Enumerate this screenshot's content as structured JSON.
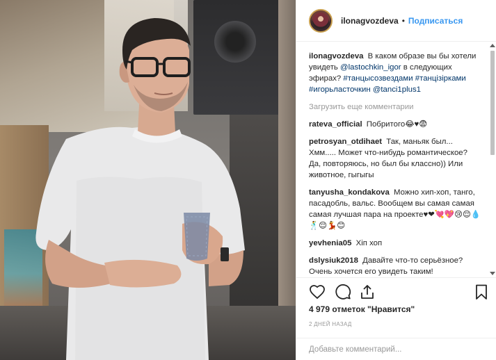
{
  "header": {
    "username": "ilonagvozdeva",
    "dot": "•",
    "follow_label": "Подписаться"
  },
  "caption": {
    "username": "ilonagvozdeva",
    "text": "В каком образе вы бы хотели увидеть",
    "mention": "@lastochkin_igor",
    "text2": "в следующих эфирах?",
    "tags": [
      "#танцысозвездами",
      "#танцізірками",
      "#игорьласточкин",
      "@tanci1plus1"
    ]
  },
  "load_more": "Загрузить еще комментарии",
  "comments": [
    {
      "user": "rateva_official",
      "text": "Побритого😂♥😨"
    },
    {
      "user": "petrosyan_otdihaet",
      "text": "Так, маньяк был... Хмм..... Может что-нибудь романтическое? Да, повторяюсь, но был бы классно)) Или животное, гыгыгы"
    },
    {
      "user": "tanyusha_kondakova",
      "text": "Можно хип-хоп, танго, пасадобль, вальс. Вообщем вы самая самая самая лучшая пара на проекте♥❤💘💖😢😌💧🕺😌💃😊"
    },
    {
      "user": "yevhenia05",
      "text": "Хіп хоп"
    },
    {
      "user": "dslysiuk2018",
      "text": "Давайте что-то серьёзное? Очень хочется его увидеть таким!"
    }
  ],
  "actions": {
    "like_icon": "heart-icon",
    "comment_icon": "comment-icon",
    "share_icon": "share-icon",
    "save_icon": "bookmark-icon"
  },
  "likes": "4 979 отметок \"Нравится\"",
  "date": "2 ДНЕЙ НАЗАД",
  "add_comment": {
    "placeholder": "Добавьте комментарий..."
  },
  "colors": {
    "link": "#003569",
    "follow": "#3897f0",
    "muted": "#999999"
  }
}
